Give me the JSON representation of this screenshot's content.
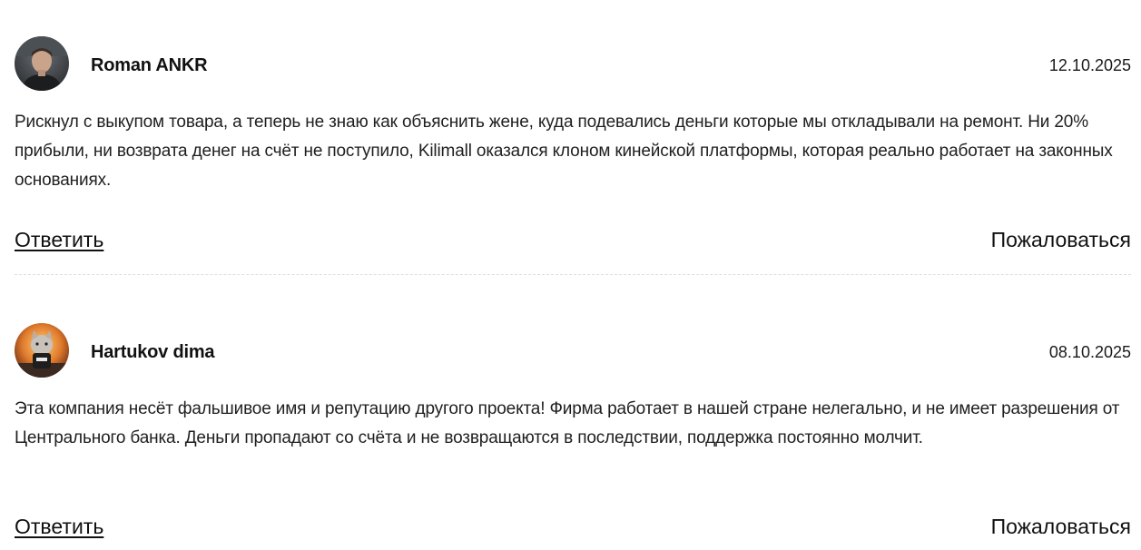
{
  "comments": [
    {
      "author": "Roman ANKR",
      "date": "12.10.2025",
      "text": "Рискнул с выкупом товара, а теперь не знаю как объяснить жене, куда подевались деньги которые мы откладывали на ремонт. Ни 20% прибыли, ни возврата денег на счёт не поступило, Kilimall оказался клоном кинейской платформы, которая реально работает на законных основаниях.",
      "reply_label": "Ответить",
      "report_label": "Пожаловаться"
    },
    {
      "author": "Hartukov dima",
      "date": "08.10.2025",
      "text": "Эта компания несёт фальшивое имя и репутацию другого проекта! Фирма работает в нашей стране нелегально, и не имеет разрешения от Центрального банка. Деньги пропадают со счёта и не возвращаются в последствии, поддержка постоянно молчит.",
      "reply_label": "Ответить",
      "report_label": "Пожаловаться"
    }
  ]
}
